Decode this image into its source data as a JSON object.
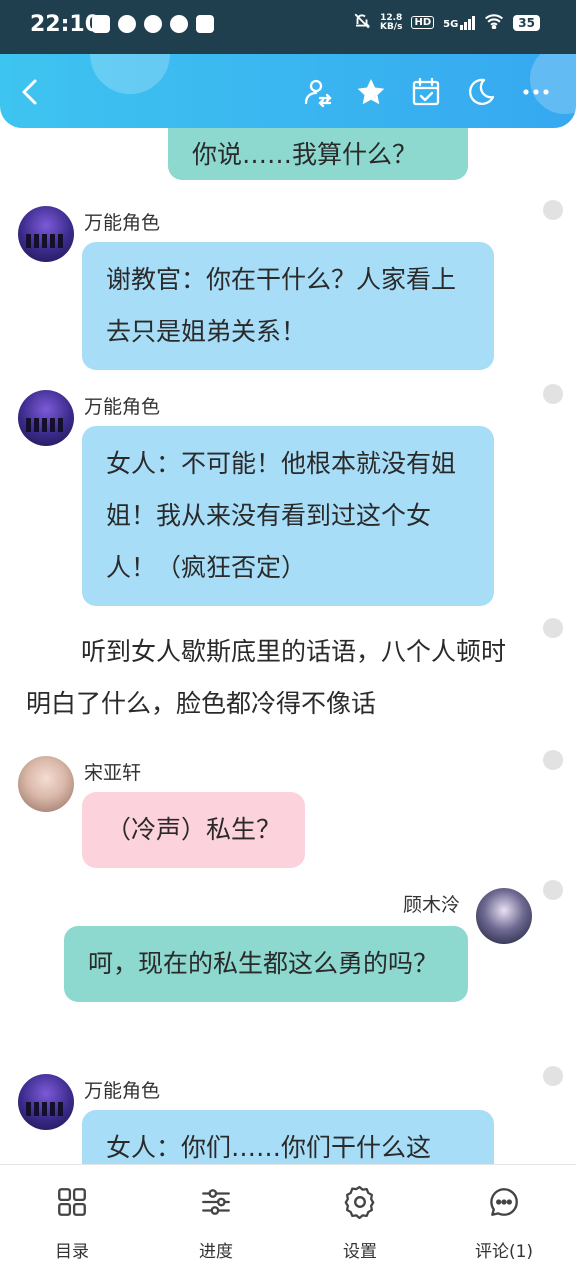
{
  "status_bar": {
    "time": "22:10",
    "left_icons": [
      "k-app-icon",
      "weibo-icon",
      "qq-icon",
      "weibo-icon",
      "app-icon"
    ],
    "network_speed": "12.8",
    "network_unit": "KB/s",
    "hd": "HD",
    "signal": "5G",
    "battery": "35"
  },
  "header": {
    "icons": [
      "back-icon",
      "switch-role-icon",
      "star-icon",
      "calendar-check-icon",
      "night-mode-icon",
      "more-icon"
    ],
    "accent": "#3ec4f0"
  },
  "messages": [
    {
      "type": "bubble",
      "text": "你说……我算什么？",
      "color": "#8ed9cf"
    },
    {
      "type": "left",
      "name": "万能角色",
      "text": "谢教官：你在干什么？人家看上去只是姐弟关系！",
      "color": "#a8ddf8"
    },
    {
      "type": "left",
      "name": "万能角色",
      "text": "女人：不可能！他根本就没有姐姐！我从来没有看到过这个女人！（疯狂否定）",
      "color": "#a8ddf8"
    },
    {
      "type": "narration",
      "text": "听到女人歇斯底里的话语，八个人顿时明白了什么，脸色都冷得不像话"
    },
    {
      "type": "left",
      "name": "宋亚轩",
      "text": "（冷声）私生？",
      "color": "#fcd3dc"
    },
    {
      "type": "right",
      "name": "顾木泠",
      "text": "呵，现在的私生都这么勇的吗？",
      "color": "#8ed9cf"
    },
    {
      "type": "left",
      "name": "万能角色",
      "text": "女人：你们……你们干什么这",
      "color": "#a8ddf8"
    }
  ],
  "bottom_nav": [
    {
      "label": "目录",
      "icon": "grid-icon"
    },
    {
      "label": "进度",
      "icon": "sliders-icon"
    },
    {
      "label": "设置",
      "icon": "gear-icon"
    },
    {
      "label": "评论(1)",
      "icon": "comment-icon"
    }
  ]
}
